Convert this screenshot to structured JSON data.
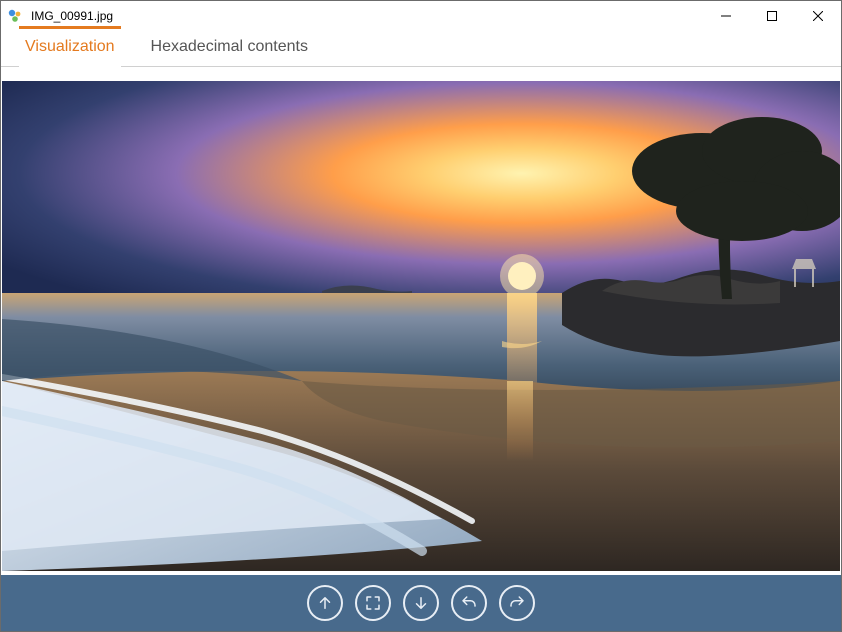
{
  "window": {
    "title": "IMG_00991.jpg"
  },
  "tabs": {
    "visualization": "Visualization",
    "hex": "Hexadecimal contents",
    "active": "visualization"
  },
  "toolbar": {
    "buttons": [
      "up",
      "fit",
      "down",
      "undo",
      "redo"
    ]
  },
  "colors": {
    "accent": "#e47a1f",
    "toolbar_bg": "#486a8c"
  }
}
